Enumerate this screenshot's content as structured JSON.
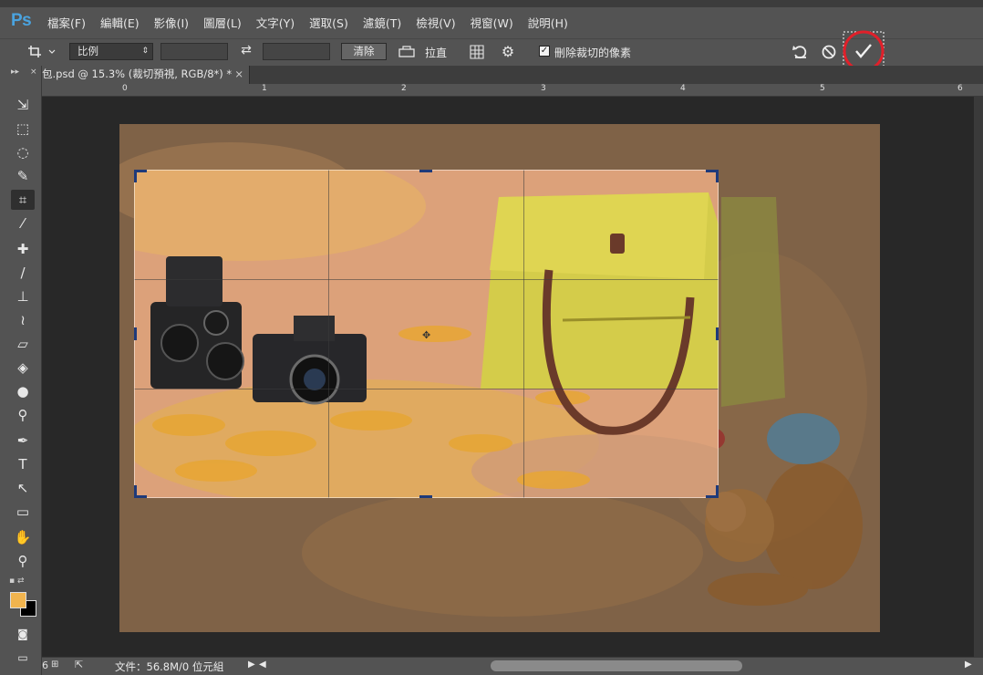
{
  "app": {
    "logo": "Ps"
  },
  "menu": [
    "檔案(F)",
    "編輯(E)",
    "影像(I)",
    "圖層(L)",
    "文字(Y)",
    "選取(S)",
    "濾鏡(T)",
    "檢視(V)",
    "視窗(W)",
    "說明(H)"
  ],
  "options": {
    "ratio_dropdown": "比例",
    "clear_button": "清除",
    "straighten_label": "拉直",
    "delete_cropped_label": "刪除裁切的像素",
    "delete_cropped_checked": true
  },
  "document_tab": {
    "title": "包.psd @ 15.3% (裁切預視, RGB/8*) *",
    "close": "×"
  },
  "ruler": {
    "ticks": [
      "0",
      "1",
      "2",
      "3",
      "4",
      "5",
      "6"
    ]
  },
  "status": {
    "zoom_fragment": "6",
    "file_info": "文件：56.8M/0 位元組"
  },
  "icons": {
    "crop_tool": "crop-icon",
    "swap": "swap-icon",
    "level": "level-icon",
    "grid_overlay": "grid-icon",
    "settings": "gear-icon",
    "reset": "reset-icon",
    "cancel": "cancel-icon",
    "commit": "checkmark-icon"
  },
  "colors": {
    "foreground": "#f1b44e",
    "background": "#000000",
    "highlight_circle": "#e0202a"
  }
}
